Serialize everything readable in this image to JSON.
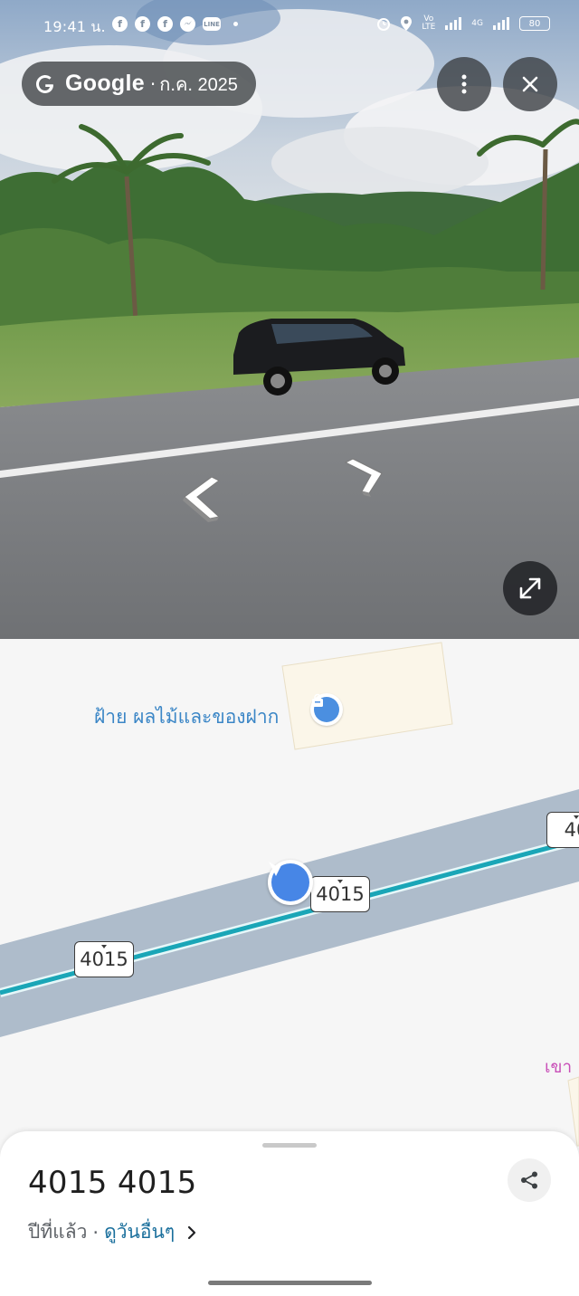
{
  "status_bar": {
    "time": "19:41 น.",
    "app_icons": [
      "facebook-icon",
      "facebook-icon",
      "facebook-icon",
      "messenger-icon",
      "line-icon"
    ],
    "line_text": "LINE",
    "right_icons": [
      "alarm-icon",
      "location-icon",
      "volte-icon",
      "signal-icon",
      "signal-icon"
    ],
    "volte_text": "Vo\nLTE",
    "net_text": "4G",
    "battery": "80"
  },
  "street_view": {
    "brand": "Google",
    "separator": "·",
    "capture_date": "ก.ค. 2025",
    "menu_icon": "more-vert-icon",
    "close_icon": "close-icon",
    "expand_icon": "expand-icon",
    "nav_icons": [
      "chevron-left-icon",
      "chevron-right-icon"
    ]
  },
  "map": {
    "poi_label": "ฝ้าย ผลไม้และของฝาก",
    "poi_icon": "shopping-bag-icon",
    "road_shields": [
      "4015",
      "4015",
      "40"
    ],
    "partial_label": "เขา",
    "location_icon": "location-arrow-icon",
    "colors": {
      "road": "#aebccb",
      "route": "#1aa6b7",
      "label": "#3b86c6",
      "pink": "#c94fb8"
    }
  },
  "sheet": {
    "title": "4015 4015",
    "when": "ปีที่แล้ว",
    "dot": "·",
    "see_more": "ดูวันอื่นๆ",
    "share_icon": "share-icon",
    "chevron_icon": "chevron-right-icon"
  }
}
